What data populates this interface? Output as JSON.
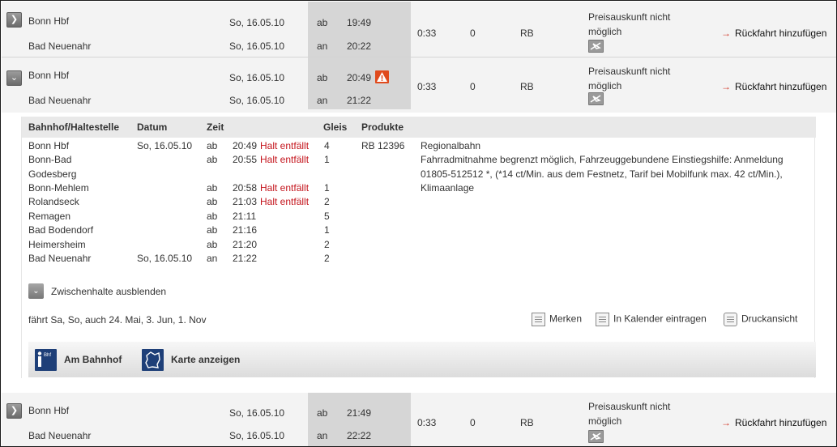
{
  "connections": [
    {
      "from": "Bonn Hbf",
      "to": "Bad Neuenahr",
      "dep_date": "So, 16.05.10",
      "arr_date": "So, 16.05.10",
      "dep_label": "ab",
      "arr_label": "an",
      "dep_time": "19:49",
      "arr_time": "20:22",
      "duration": "0:33",
      "changes": "0",
      "products": "RB",
      "price": "Preisauskunft nicht möglich",
      "return_link": "Rückfahrt hinzufügen"
    },
    {
      "from": "Bonn Hbf",
      "to": "Bad Neuenahr",
      "dep_date": "So, 16.05.10",
      "arr_date": "So, 16.05.10",
      "dep_label": "ab",
      "arr_label": "an",
      "dep_time": "20:49",
      "arr_time": "21:22",
      "duration": "0:33",
      "changes": "0",
      "products": "RB",
      "price": "Preisauskunft nicht möglich",
      "return_link": "Rückfahrt hinzufügen"
    },
    {
      "from": "Bonn Hbf",
      "to": "Bad Neuenahr",
      "dep_date": "So, 16.05.10",
      "arr_date": "So, 16.05.10",
      "dep_label": "ab",
      "arr_label": "an",
      "dep_time": "21:49",
      "arr_time": "22:22",
      "duration": "0:33",
      "changes": "0",
      "products": "RB",
      "price": "Preisauskunft nicht möglich",
      "return_link": "Rückfahrt hinzufügen"
    }
  ],
  "detail": {
    "headers": {
      "station": "Bahnhof/Haltestelle",
      "date": "Datum",
      "time": "Zeit",
      "track": "Gleis",
      "products": "Produkte"
    },
    "stops": [
      {
        "station": "Bonn Hbf",
        "date": "So, 16.05.10",
        "type": "ab",
        "time": "20:49",
        "note": "Halt entfällt",
        "track": "4",
        "product": "RB 12396"
      },
      {
        "station": "Bonn-Bad",
        "station2": "Godesberg",
        "date": "",
        "type": "ab",
        "time": "20:55",
        "note": "Halt entfällt",
        "track": "1",
        "product": ""
      },
      {
        "station": "Bonn-Mehlem",
        "date": "",
        "type": "ab",
        "time": "20:58",
        "note": "Halt entfällt",
        "track": "1",
        "product": ""
      },
      {
        "station": "Rolandseck",
        "date": "",
        "type": "ab",
        "time": "21:03",
        "note": "Halt entfällt",
        "track": "2",
        "product": ""
      },
      {
        "station": "Remagen",
        "date": "",
        "type": "ab",
        "time": "21:11",
        "note": "",
        "track": "5",
        "product": ""
      },
      {
        "station": "Bad Bodendorf",
        "date": "",
        "type": "ab",
        "time": "21:16",
        "note": "",
        "track": "1",
        "product": ""
      },
      {
        "station": "Heimersheim",
        "date": "",
        "type": "ab",
        "time": "21:20",
        "note": "",
        "track": "2",
        "product": ""
      },
      {
        "station": "Bad Neuenahr",
        "date": "So, 16.05.10",
        "type": "an",
        "time": "21:22",
        "note": "",
        "track": "2",
        "product": ""
      }
    ],
    "train_type": "Regionalbahn",
    "train_info": "Fahrradmitnahme begrenzt möglich, Fahrzeuggebundene Einstiegshilfe: Anmeldung 01805-512512 *, (*14 ct/Min. aus dem Festnetz, Tarif bei Mobilfunk max. 42 ct/Min.), Klimaanlage",
    "collapse_label": "Zwischenhalte ausblenden",
    "runs_text": "fährt Sa, So, auch 24. Mai, 3. Jun, 1. Nov",
    "actions": {
      "remember": "Merken",
      "calendar": "In Kalender eintragen",
      "print": "Druckansicht"
    },
    "toolbar": {
      "station_info": "Am Bahnhof",
      "map": "Karte anzeigen"
    }
  },
  "colors": {
    "warning_red": "#c4141c",
    "toolbar_blue": "#1e3f78",
    "row_bg": "#f3f3f3",
    "time_bg": "#d6d6d6"
  },
  "icons": [
    "chevron-right-icon",
    "chevron-down-icon",
    "warning-icon",
    "no-price-icon",
    "arrow-right-icon",
    "notepad-icon",
    "calendar-icon",
    "printer-icon",
    "info-icon",
    "map-icon"
  ]
}
